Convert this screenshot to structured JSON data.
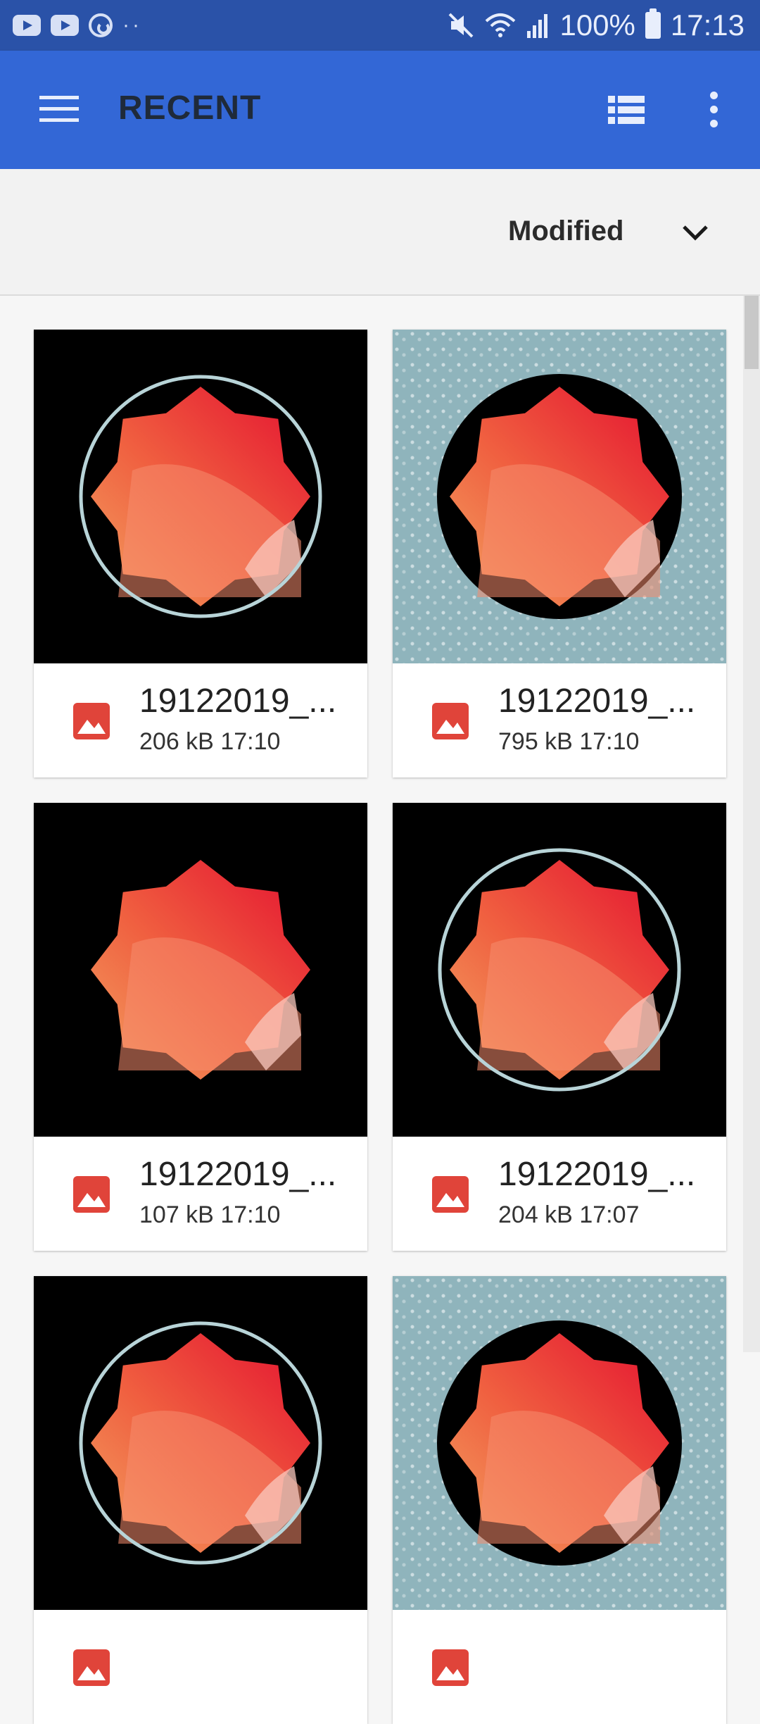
{
  "status_bar": {
    "battery": "100%",
    "time": "17:13",
    "icons": [
      "youtube-icon",
      "youtube-icon",
      "sync-icon",
      "more-dots-icon",
      "mute-icon",
      "wifi-icon",
      "signal-icon",
      "battery-icon"
    ]
  },
  "app_bar": {
    "title": "RECENT",
    "menu_icon": "menu-icon",
    "view_icon": "list-view-icon",
    "overflow_icon": "more-vert-icon"
  },
  "sort": {
    "label": "Modified",
    "icon": "chevron-down-icon"
  },
  "files": [
    {
      "name": "19122019_...",
      "size": "206 kB",
      "time": "17:10",
      "thumb": "black-ring"
    },
    {
      "name": "19122019_...",
      "size": "795 kB",
      "time": "17:10",
      "thumb": "pattern-disc"
    },
    {
      "name": "19122019_...",
      "size": "107 kB",
      "time": "17:10",
      "thumb": "black-plain"
    },
    {
      "name": "19122019_...",
      "size": "204 kB",
      "time": "17:07",
      "thumb": "black-ring"
    },
    {
      "name": "",
      "size": "",
      "time": "",
      "thumb": "black-ring"
    },
    {
      "name": "",
      "size": "",
      "time": "",
      "thumb": "pattern-disc"
    }
  ],
  "colors": {
    "status_bar": "#2a52a8",
    "app_bar": "#3367d6",
    "image_icon": "#e0443a"
  }
}
